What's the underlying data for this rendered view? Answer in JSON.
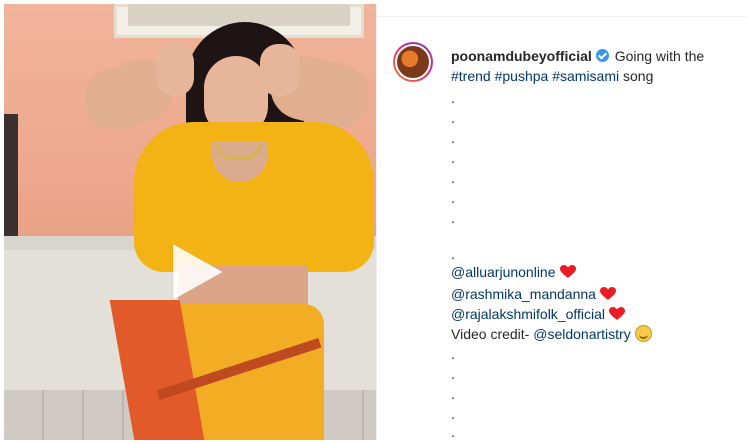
{
  "post": {
    "username": "poonamdubeyofficial",
    "caption_text": "Going with the",
    "hashtags": [
      "#trend",
      "#pushpa",
      "#samisami"
    ],
    "caption_tail": "song",
    "mentions": [
      {
        "handle": "@alluarjunonline",
        "emoji": "red-heart"
      },
      {
        "handle": "@rashmika_mandanna",
        "emoji": "red-heart"
      },
      {
        "handle": "@rajalakshmifolk_official",
        "emoji": "red-heart"
      }
    ],
    "credit_label": "Video credit-",
    "credit_handle": "@seldonartistry",
    "credit_emoji": "smiling-face",
    "dot": "."
  },
  "media": {
    "type": "video",
    "play_icon": "play-icon"
  },
  "colors": {
    "link": "#00376b",
    "text": "#262626",
    "verified": "#3897f0",
    "heart": "#ed1c24"
  }
}
